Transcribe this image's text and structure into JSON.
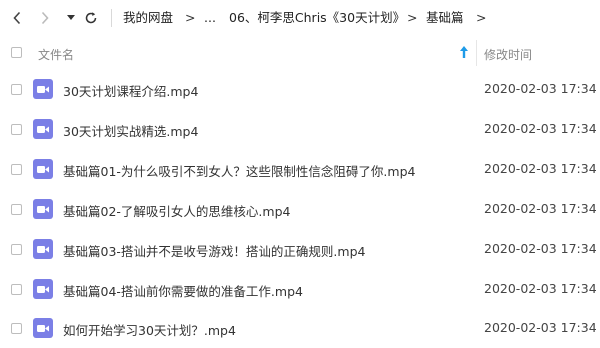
{
  "toolbar": {
    "back_icon": "chevron-left-icon",
    "forward_icon": "chevron-right-icon",
    "dropdown_icon": "caret-down-icon",
    "refresh_icon": "refresh-icon",
    "breadcrumb": [
      "我的网盘",
      "...",
      "06、柯李思Chris《30天计划》",
      "基础篇"
    ],
    "separator": ">"
  },
  "header": {
    "name_label": "文件名",
    "time_label": "修改时间",
    "sort_icon": "sort-up-icon"
  },
  "files": [
    {
      "name": "30天计划课程介绍.mp4",
      "time": "2020-02-03 17:34",
      "icon": "video-file-icon"
    },
    {
      "name": "30天计划实战精选.mp4",
      "time": "2020-02-03 17:34",
      "icon": "video-file-icon"
    },
    {
      "name": "基础篇01-为什么吸引不到女人？这些限制性信念阻碍了你.mp4",
      "time": "2020-02-03 17:34",
      "icon": "video-file-icon"
    },
    {
      "name": "基础篇02-了解吸引女人的思维核心.mp4",
      "time": "2020-02-03 17:34",
      "icon": "video-file-icon"
    },
    {
      "name": "基础篇03-搭讪并不是收号游戏！搭讪的正确规则.mp4",
      "time": "2020-02-03 17:34",
      "icon": "video-file-icon"
    },
    {
      "name": "基础篇04-搭讪前你需要做的准备工作.mp4",
      "time": "2020-02-03 17:34",
      "icon": "video-file-icon"
    },
    {
      "name": "如何开始学习30天计划？.mp4",
      "time": "2020-02-03 17:34",
      "icon": "video-file-icon"
    }
  ],
  "colors": {
    "video_icon": "#7b7fe6",
    "sort_icon": "#1e9be8"
  }
}
